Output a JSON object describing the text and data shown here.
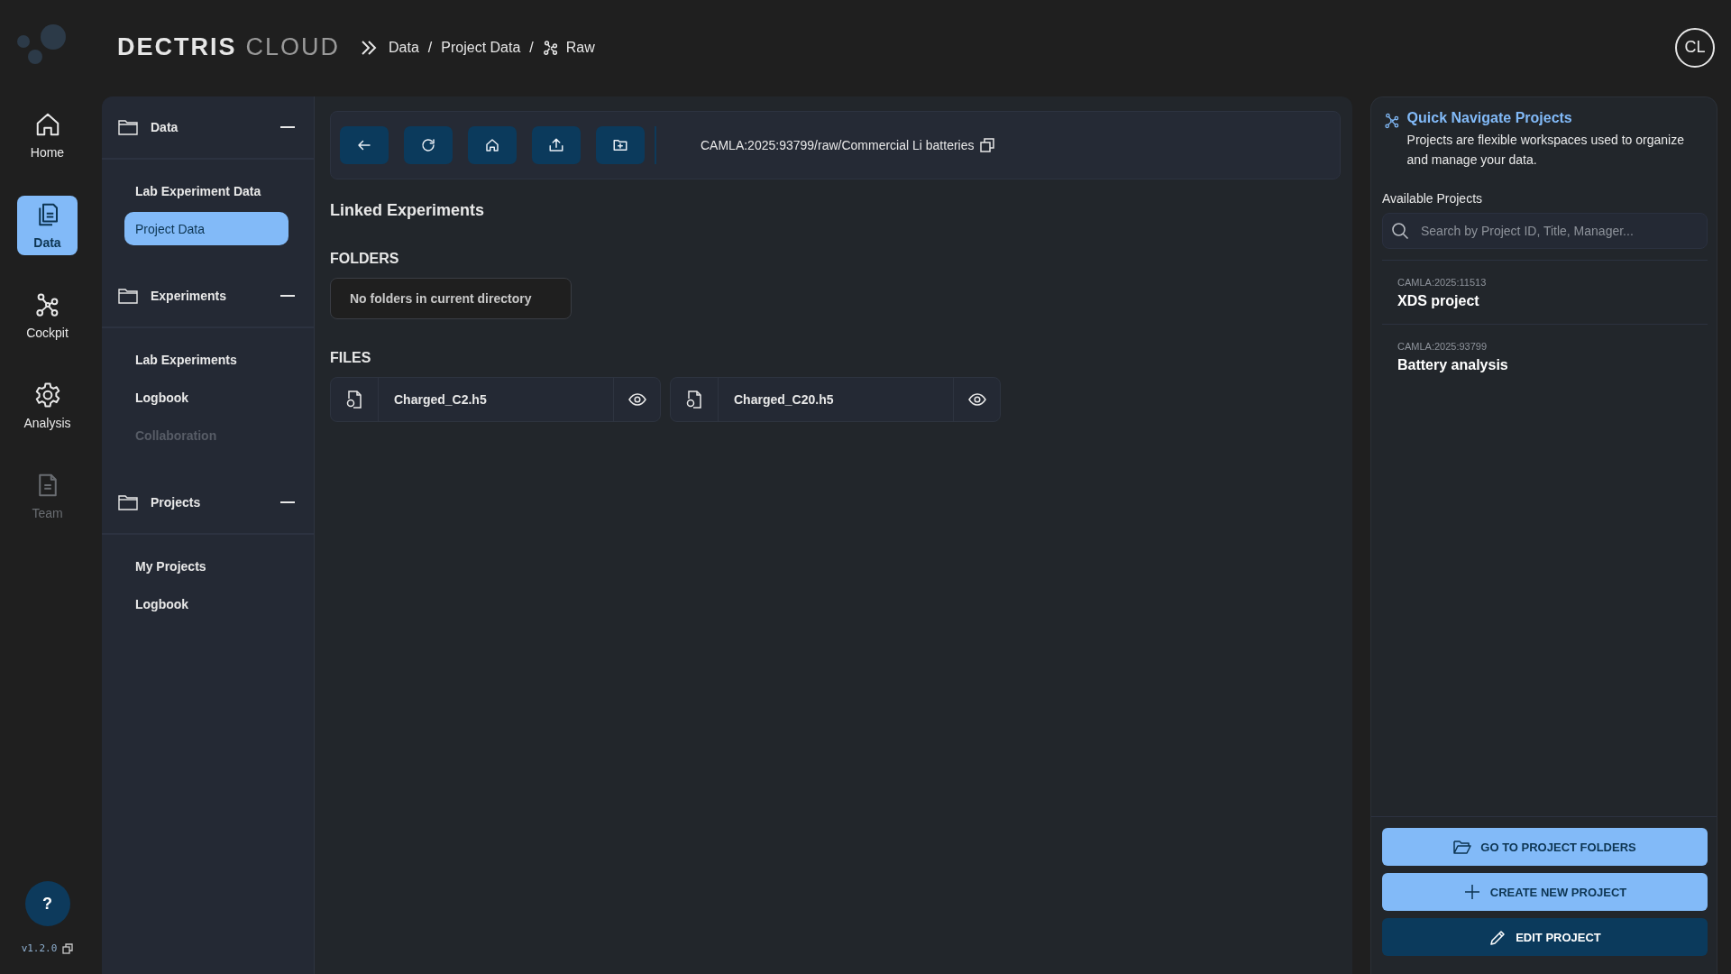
{
  "header": {
    "logo": {
      "brand": "DECTRIS",
      "product": "CLOUD"
    },
    "separator": "/",
    "breadcrumb": [
      {
        "label": "Data"
      },
      {
        "label": "Project Data"
      },
      {
        "label": "Raw"
      }
    ],
    "avatar": "CL"
  },
  "rail": {
    "items": [
      {
        "label": "Home",
        "selected": false,
        "disabled": false
      },
      {
        "label": "Data",
        "selected": true,
        "disabled": false
      },
      {
        "label": "Cockpit",
        "selected": false,
        "disabled": false
      },
      {
        "label": "Analysis",
        "selected": false,
        "disabled": false
      },
      {
        "label": "Team",
        "selected": false,
        "disabled": true
      }
    ],
    "help": "?",
    "version": "v1.2.0"
  },
  "sidebar": {
    "sections": [
      {
        "title": "Data",
        "expanded": true,
        "items": [
          {
            "label": "Lab Experiment Data",
            "selected": false,
            "disabled": false
          },
          {
            "label": "Project Data",
            "selected": true,
            "disabled": false
          }
        ]
      },
      {
        "title": "Experiments",
        "expanded": true,
        "items": [
          {
            "label": "Lab Experiments",
            "selected": false,
            "disabled": false
          },
          {
            "label": "Logbook",
            "selected": false,
            "disabled": false
          },
          {
            "label": "Collaboration",
            "selected": false,
            "disabled": true
          }
        ]
      },
      {
        "title": "Projects",
        "expanded": true,
        "items": [
          {
            "label": "My Projects",
            "selected": false,
            "disabled": false
          },
          {
            "label": "Logbook",
            "selected": false,
            "disabled": false
          }
        ]
      }
    ]
  },
  "browser": {
    "path": "CAMLA:2025:93799/raw/Commercial Li batteries",
    "title": "Linked Experiments",
    "folders": {
      "heading": "FOLDERS",
      "empty_message": "No folders in current directory"
    },
    "files": {
      "heading": "FILES",
      "items": [
        {
          "name": "Charged_C2.h5"
        },
        {
          "name": "Charged_C20.h5"
        }
      ]
    }
  },
  "quick_nav": {
    "title": "Quick Navigate Projects",
    "description": "Projects are flexible workspaces used to organize and manage your data.",
    "list_label": "Available Projects",
    "search": {
      "placeholder": "Search by Project ID, Title, Manager..."
    },
    "projects": [
      {
        "id": "CAMLA:2025:11513",
        "name": "XDS project"
      },
      {
        "id": "CAMLA:2025:93799",
        "name": "Battery analysis"
      }
    ],
    "buttons": [
      {
        "label": "GO TO PROJECT FOLDERS",
        "kind": "light"
      },
      {
        "label": "CREATE NEW PROJECT",
        "kind": "light"
      },
      {
        "label": "EDIT PROJECT",
        "kind": "dark"
      }
    ]
  }
}
